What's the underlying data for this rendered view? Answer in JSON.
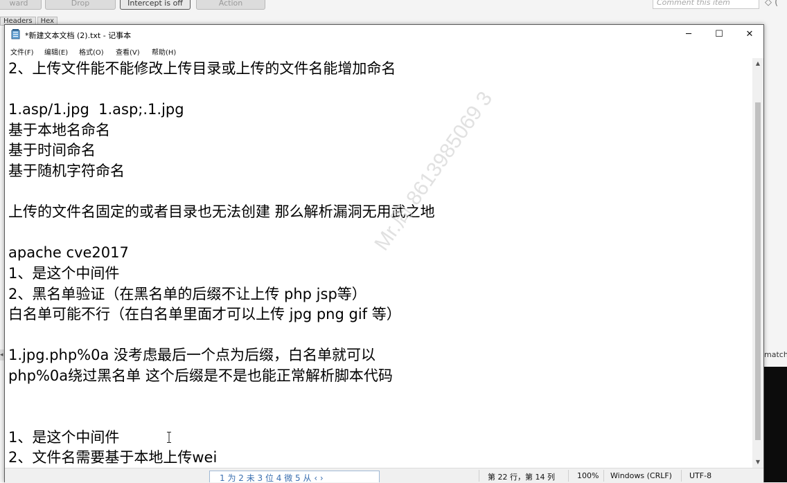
{
  "background_app": {
    "buttons": [
      "ward",
      "Drop",
      "Intercept is off",
      "Action"
    ],
    "comment_placeholder": "Comment this item",
    "tabs": [
      "Headers",
      "Hex"
    ],
    "right_label": "match"
  },
  "window": {
    "title": "*新建文本文档 (2).txt - 记事本",
    "controls": {
      "minimize": "─",
      "maximize": "☐",
      "close": "✕"
    }
  },
  "menu": {
    "items": [
      "文件(F)",
      "编辑(E)",
      "格式(O)",
      "查看(V)",
      "帮助(H)"
    ]
  },
  "editor": {
    "lines": [
      "2、上传文件能不能修改上传目录或上传的文件名能增加命名",
      "",
      "1.asp/1.jpg  1.asp;.1.jpg",
      "基于本地名命名",
      "基于时间命名",
      "基于随机字符命名",
      "",
      "上传的文件名固定的或者目录也无法创建 那么解析漏洞无用武之地",
      "",
      "apache cve2017",
      "1、是这个中间件",
      "2、黑名单验证（在黑名单的后缀不让上传 php jsp等）",
      "白名单可能不行（在白名单里面才可以上传 jpg png gif 等）",
      "",
      "1.jpg.php%0a 没考虑最后一个点为后缀，白名单就可以",
      "php%0a绕过黑名单 这个后缀是不是也能正常解析脚本代码",
      "",
      "",
      "1、是这个中间件",
      "2、文件名需要基于本地上传wei"
    ]
  },
  "watermark": "Mr.周 8613985069 3",
  "status": {
    "position": "第 22 行，第 14 列",
    "zoom": "100%",
    "line_ending": "Windows (CRLF)",
    "encoding": "UTF-8"
  },
  "ime": {
    "candidates": "1 为  2 未  3 位  4 微  5 从  ‹ ›"
  }
}
